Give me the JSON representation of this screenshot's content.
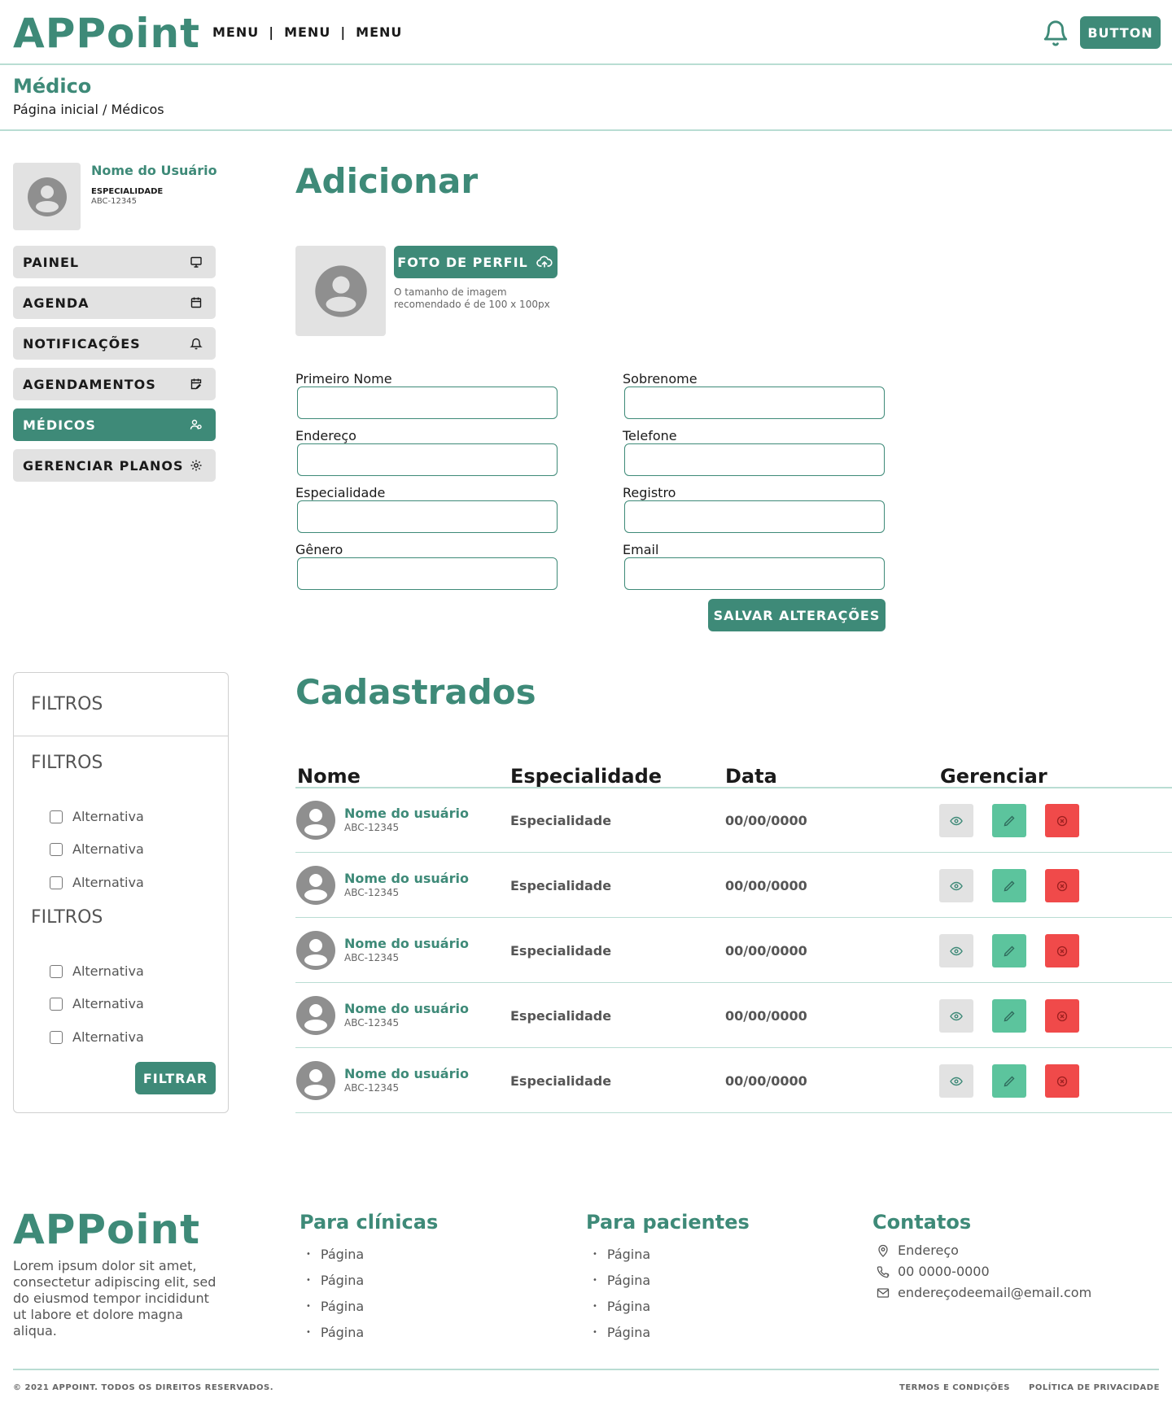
{
  "header": {
    "logo": "APPoint",
    "menu": [
      "MENU",
      "MENU",
      "MENU"
    ],
    "separator": "|",
    "button_label": "BUTTON"
  },
  "page": {
    "title": "Médico",
    "breadcrumb": "Página inicial  / Médicos"
  },
  "user": {
    "name": "Nome do Usuário",
    "specialty": "ESPECIALIDADE",
    "code": "ABC-12345"
  },
  "sidebar": {
    "items": [
      {
        "label": "PAINEL",
        "icon": "monitor-icon"
      },
      {
        "label": "AGENDA",
        "icon": "calendar-icon"
      },
      {
        "label": "NOTIFICAÇÕES",
        "icon": "bell-icon"
      },
      {
        "label": "AGENDAMENTOS",
        "icon": "calendar-edit-icon"
      },
      {
        "label": "MÉDICOS",
        "icon": "users-icon",
        "active": true
      },
      {
        "label": "GERENCIAR PLANOS",
        "icon": "gear-icon"
      }
    ]
  },
  "add_form": {
    "title": "Adicionar",
    "photo_button": "FOTO DE PERFIL",
    "photo_hint": "O tamanho de imagem recomendado é de 100 x 100px",
    "fields": {
      "first_name": {
        "label": "Primeiro Nome",
        "value": ""
      },
      "last_name": {
        "label": "Sobrenome",
        "value": ""
      },
      "address": {
        "label": "Endereço",
        "value": ""
      },
      "phone": {
        "label": "Telefone",
        "value": ""
      },
      "specialty": {
        "label": "Especialidade",
        "value": ""
      },
      "registry": {
        "label": "Registro",
        "value": ""
      },
      "gender": {
        "label": "Gênero",
        "value": ""
      },
      "email": {
        "label": "Email",
        "value": ""
      }
    },
    "save_button": "SALVAR ALTERAÇÕES"
  },
  "filters": {
    "header": "FILTROS",
    "groups": [
      {
        "title": "FILTROS",
        "options": [
          "Alternativa",
          "Alternativa",
          "Alternativa"
        ]
      },
      {
        "title": "FILTROS",
        "options": [
          "Alternativa",
          "Alternativa",
          "Alternativa"
        ]
      }
    ],
    "button": "FILTRAR"
  },
  "registered": {
    "title": "Cadastrados",
    "columns": [
      "Nome",
      "Especialidade",
      "Data",
      "Gerenciar"
    ],
    "rows": [
      {
        "name": "Nome do usuário",
        "code": "ABC-12345",
        "specialty": "Especialidade",
        "date": "00/00/0000"
      },
      {
        "name": "Nome do usuário",
        "code": "ABC-12345",
        "specialty": "Especialidade",
        "date": "00/00/0000"
      },
      {
        "name": "Nome do usuário",
        "code": "ABC-12345",
        "specialty": "Especialidade",
        "date": "00/00/0000"
      },
      {
        "name": "Nome do usuário",
        "code": "ABC-12345",
        "specialty": "Especialidade",
        "date": "00/00/0000"
      },
      {
        "name": "Nome do usuário",
        "code": "ABC-12345",
        "specialty": "Especialidade",
        "date": "00/00/0000"
      }
    ]
  },
  "footer": {
    "logo": "APPoint",
    "about": "Lorem ipsum dolor sit amet, consectetur adipiscing elit, sed do eiusmod tempor incididunt ut labore et dolore magna aliqua.",
    "clinics": {
      "title": "Para clínicas",
      "links": [
        "Página",
        "Página",
        "Página",
        "Página"
      ]
    },
    "patients": {
      "title": "Para pacientes",
      "links": [
        "Página",
        "Página",
        "Página",
        "Página"
      ]
    },
    "contacts": {
      "title": "Contatos",
      "address": "Endereço",
      "phone": "00 0000-0000",
      "email": "endereçodeemail@email.com"
    },
    "copyright": "© 2021 APPOINT. TODOS OS DIREITOS RESERVADOS.",
    "terms": "TERMOS E CONDIÇÕES",
    "privacy": "POLÍTICA DE PRIVACIDADE"
  },
  "colors": {
    "primary": "#3e8a78",
    "light_line": "#b9ddd3",
    "grey_bg": "#e2e2e2",
    "edit_green": "#5cc49d",
    "delete_red": "#f04a4a"
  }
}
